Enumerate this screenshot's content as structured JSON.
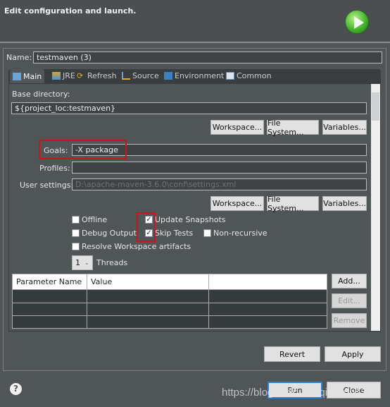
{
  "header": {
    "title": "Edit configuration and launch.",
    "icon": "run-launch-icon"
  },
  "name": {
    "label": "Name:",
    "value": "testmaven (3)"
  },
  "tabs": [
    {
      "label": "Main",
      "icon": "main-tab-icon"
    },
    {
      "label": "JRE",
      "icon": "jre-icon"
    },
    {
      "label": "Refresh",
      "icon": "refresh-icon"
    },
    {
      "label": "Source",
      "icon": "source-icon"
    },
    {
      "label": "Environment",
      "icon": "environment-icon"
    },
    {
      "label": "Common",
      "icon": "common-icon"
    }
  ],
  "main": {
    "base_dir_label": "Base directory:",
    "base_dir_value": "${project_loc:testmaven}",
    "buttons": {
      "workspace": "Workspace...",
      "file_system": "File System...",
      "variables": "Variables..."
    },
    "goals_label": "Goals:",
    "goals_value": "-X package",
    "profiles_label": "Profiles:",
    "profiles_value": "",
    "user_settings_label": "User settings:",
    "user_settings_value": "D:\\apache-maven-3.6.0\\conf\\settings.xml",
    "checkboxes": {
      "offline": {
        "label": "Offline",
        "checked": false
      },
      "update_snapshots": {
        "label": "Update Snapshots",
        "checked": true
      },
      "debug_output": {
        "label": "Debug Output",
        "checked": false
      },
      "skip_tests": {
        "label": "Skip Tests",
        "checked": true
      },
      "non_recursive": {
        "label": "Non-recursive",
        "checked": false
      },
      "resolve_workspace": {
        "label": "Resolve Workspace artifacts",
        "checked": false
      }
    },
    "threads_value": "1",
    "threads_label": "Threads",
    "table": {
      "columns": [
        "Parameter Name",
        "Value",
        ""
      ],
      "rows": []
    },
    "table_buttons": {
      "add": "Add...",
      "edit": "Edit...",
      "remove": "Remove"
    }
  },
  "footer": {
    "revert": "Revert",
    "apply": "Apply",
    "run": "Run",
    "close": "Close",
    "help_icon": "help-icon"
  },
  "watermark": "https://blog.csdn.net/qinsijun123"
}
